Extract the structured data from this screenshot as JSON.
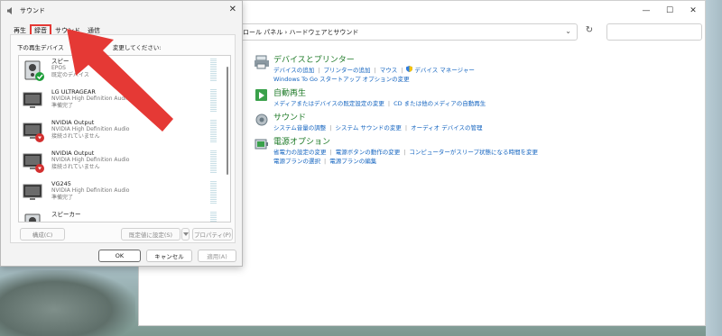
{
  "colors": {
    "link": "#1565c0",
    "category": "#1e7a27",
    "highlight": "#e53935",
    "arrow": "#e53935"
  },
  "control_panel": {
    "window_controls": [
      "—",
      "☐",
      "✕"
    ],
    "address": "ロール パネル  ›  ハードウェアとサウンド",
    "categories": [
      {
        "icon": "printer-icon",
        "title": "デバイスとプリンター",
        "rows": [
          [
            "デバイスの追加",
            "プリンターの追加",
            "マウス",
            "デバイス マネージャー"
          ],
          [
            "Windows To Go スタートアップ オプションの変更"
          ]
        ]
      },
      {
        "icon": "autoplay-icon",
        "title": "自動再生",
        "rows": [
          [
            "メディアまたはデバイスの既定設定の変更",
            "CD または他のメディアの自動再生"
          ]
        ]
      },
      {
        "icon": "speaker-icon",
        "title": "サウンド",
        "rows": [
          [
            "システム音量の調整",
            "システム サウンドの変更",
            "オーディオ デバイスの管理"
          ]
        ]
      },
      {
        "icon": "battery-icon",
        "title": "電源オプション",
        "rows": [
          [
            "省電力の設定の変更",
            "電源ボタンの動作の変更",
            "コンピューターがスリープ状態になる時間を変更"
          ],
          [
            "電源プランの選択",
            "電源プランの編集"
          ]
        ]
      }
    ]
  },
  "sound_dialog": {
    "title": "サウンド",
    "close": "✕",
    "tabs": [
      {
        "label": "再生"
      },
      {
        "label": "録音"
      },
      {
        "label": "サウンド"
      },
      {
        "label": "通信"
      }
    ],
    "instruction_left": "下の再生デバイス",
    "instruction_right": "変更してください:",
    "devices": [
      {
        "name": "スピー",
        "driver": "EPOS",
        "status": "既定のデバイス",
        "icon": "speaker-icon",
        "badge": "check"
      },
      {
        "name": "LG ULTRAGEAR",
        "driver": "NVIDIA High Definition Audio",
        "status": "準備完了",
        "icon": "monitor-icon",
        "badge": ""
      },
      {
        "name": "NVIDIA Output",
        "driver": "NVIDIA High Definition Audio",
        "status": "接続されていません",
        "icon": "monitor-icon",
        "badge": "down"
      },
      {
        "name": "NVIDIA Output",
        "driver": "NVIDIA High Definition Audio",
        "status": "接続されていません",
        "icon": "monitor-icon",
        "badge": "down"
      },
      {
        "name": "VG245",
        "driver": "NVIDIA High Definition Audio",
        "status": "準備完了",
        "icon": "monitor-icon",
        "badge": ""
      },
      {
        "name": "スピーカー",
        "driver": "",
        "status": "",
        "icon": "speaker-icon",
        "badge": ""
      }
    ],
    "buttons": {
      "configure": "構成(C)",
      "set_default": "既定値に設定(S)",
      "properties": "プロパティ(P)"
    },
    "footer": {
      "ok": "OK",
      "cancel": "キャンセル",
      "apply": "適用(A)"
    }
  }
}
